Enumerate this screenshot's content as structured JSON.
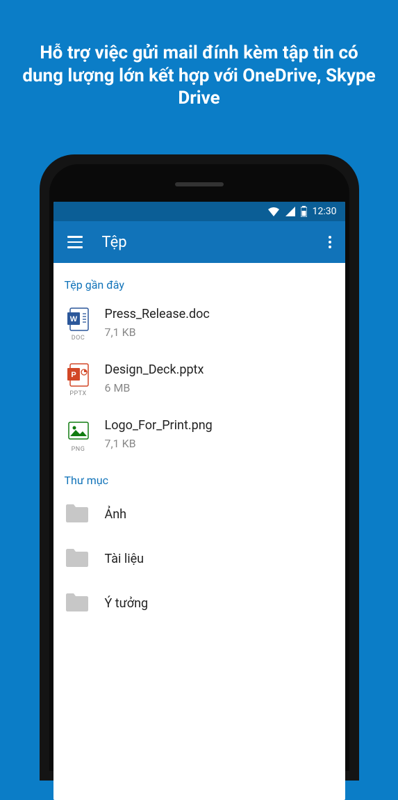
{
  "promo": "Hỗ trợ việc gửi mail đính kèm tập tin có dung lượng lớn kết hợp với OneDrive, Skype Drive",
  "statusbar": {
    "time": "12:30"
  },
  "appbar": {
    "title": "Tệp"
  },
  "sections": {
    "recent_label": "Tệp gần đây",
    "folders_label": "Thư mục"
  },
  "files": [
    {
      "name": "Press_Release.doc",
      "size": "7,1 KB",
      "ext": "DOC",
      "type": "word"
    },
    {
      "name": "Design_Deck.pptx",
      "size": "6 MB",
      "ext": "PPTX",
      "type": "powerpoint"
    },
    {
      "name": "Logo_For_Print.png",
      "size": "7,1 KB",
      "ext": "PNG",
      "type": "image"
    }
  ],
  "folders": [
    {
      "name": "Ảnh"
    },
    {
      "name": "Tài liệu"
    },
    {
      "name": "Ý tưởng"
    }
  ]
}
